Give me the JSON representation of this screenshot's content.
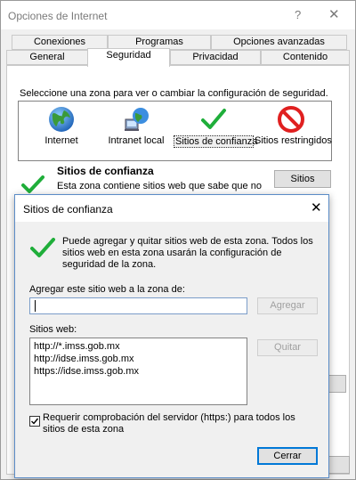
{
  "window": {
    "title": "Opciones de Internet",
    "help": "?",
    "close": "✕"
  },
  "tabs": {
    "row1": [
      "Conexiones",
      "Programas",
      "Opciones avanzadas"
    ],
    "row2": [
      "General",
      "Seguridad",
      "Privacidad",
      "Contenido"
    ],
    "active": "Seguridad"
  },
  "security": {
    "zone_prompt": "Seleccione una zona para ver o cambiar la configuración de seguridad.",
    "zones": [
      {
        "label": "Internet",
        "icon": "globe-icon"
      },
      {
        "label": "Intranet local",
        "icon": "intranet-icon"
      },
      {
        "label": "Sitios de confianza",
        "icon": "checkmark-icon",
        "selected": true
      },
      {
        "label": "Sitios restringidos",
        "icon": "restricted-icon"
      }
    ],
    "trusted_title": "Sitios de confianza",
    "trusted_desc": "Esta zona contiene sitios web que sabe que no",
    "sites_button": "Sitios"
  },
  "dialog": {
    "title": "Sitios de confianza",
    "close": "✕",
    "info": "Puede agregar y quitar sitios web de esta zona. Todos los sitios web en esta zona usarán la configuración de seguridad de la zona.",
    "add_label": "Agregar este sitio web a la zona de:",
    "add_input_value": "",
    "add_button": "Agregar",
    "sites_label": "Sitios web:",
    "sites": [
      "http://*.imss.gob.mx",
      "http://idse.imss.gob.mx",
      "https://idse.imss.gob.mx"
    ],
    "remove_button": "Quitar",
    "require_https_label": "Requerir comprobación del servidor (https:) para todos los sitios de esta zona",
    "require_https_checked": true,
    "close_button": "Cerrar"
  },
  "colors": {
    "check_green": "#1fae3a",
    "focus_blue": "#0078d7",
    "restricted_red": "#e02020"
  }
}
